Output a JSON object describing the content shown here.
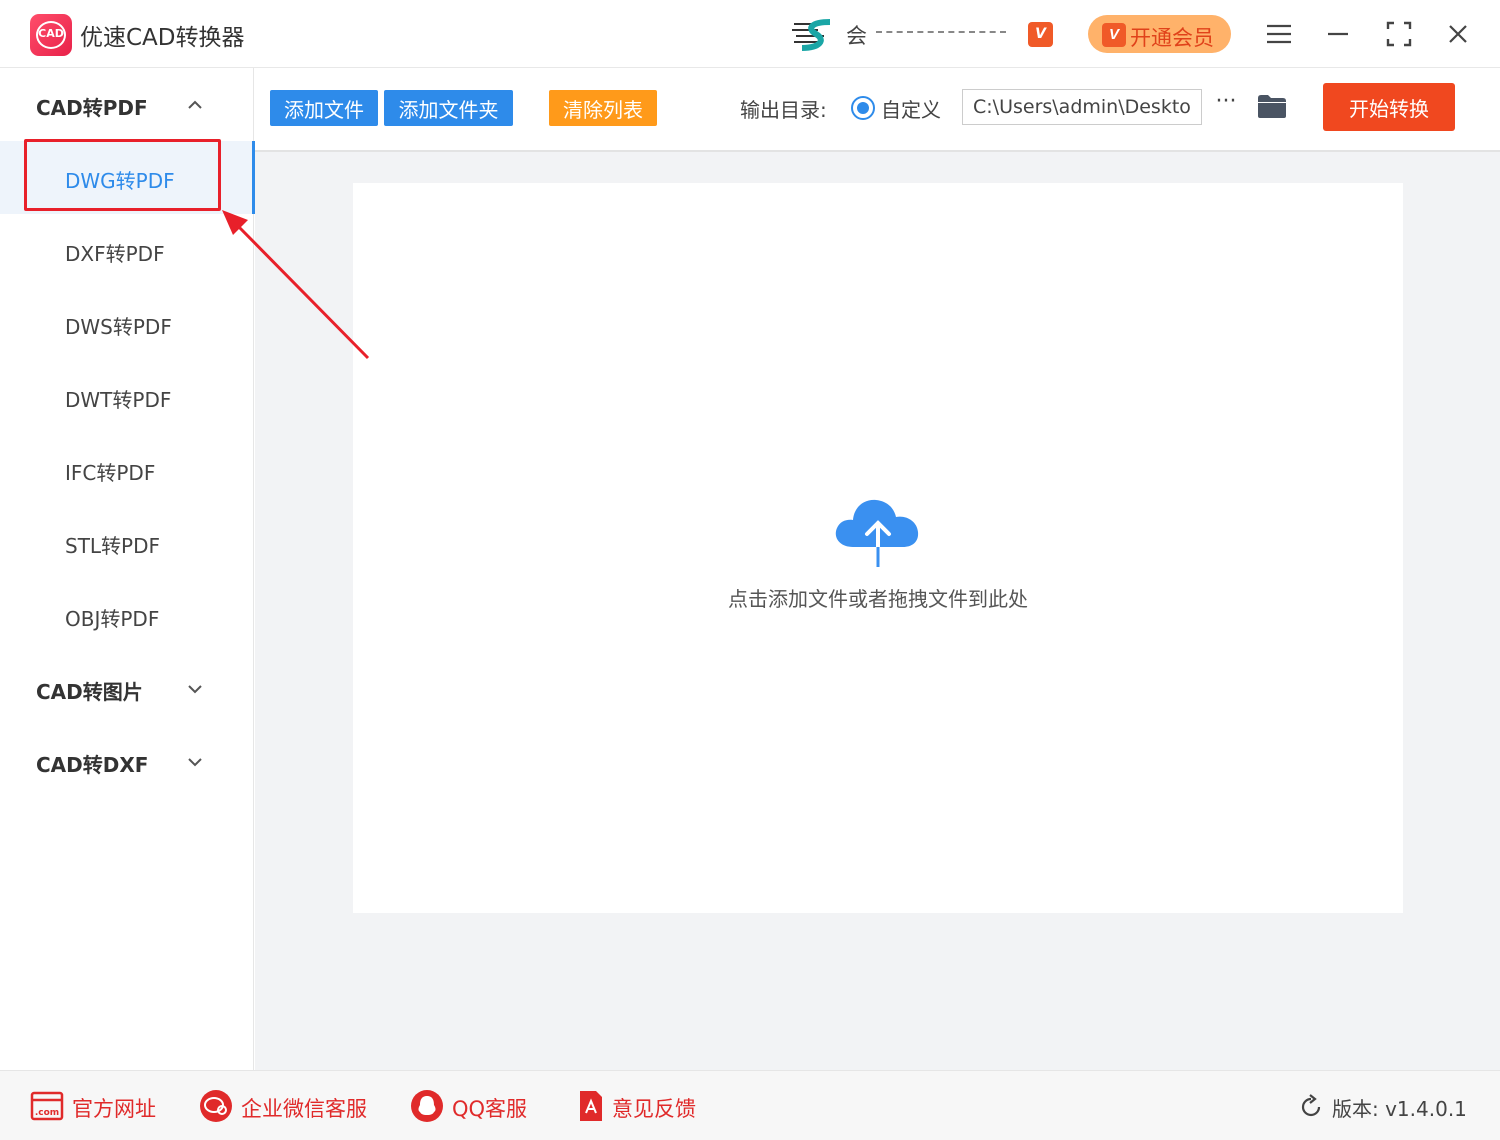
{
  "app": {
    "title": "优速CAD转换器",
    "logo_text": "CAD"
  },
  "user": {
    "name_prefix": "会",
    "vip_badge": "V",
    "upgrade_label": "开通会员",
    "upgrade_badge": "V"
  },
  "sidebar": {
    "groups": [
      {
        "label": "CAD转PDF",
        "expanded": true,
        "items": [
          "DWG转PDF",
          "DXF转PDF",
          "DWS转PDF",
          "DWT转PDF",
          "IFC转PDF",
          "STL转PDF",
          "OBJ转PDF"
        ],
        "active_index": 0
      },
      {
        "label": "CAD转图片",
        "expanded": false
      },
      {
        "label": "CAD转DXF",
        "expanded": false
      }
    ]
  },
  "toolbar": {
    "add_file": "添加文件",
    "add_folder": "添加文件夹",
    "clear_list": "清除列表",
    "output_label": "输出目录:",
    "radio_label": "自定义",
    "output_path": "C:\\Users\\admin\\Deskto",
    "more": "···",
    "start": "开始转换"
  },
  "dropzone": {
    "hint": "点击添加文件或者拖拽文件到此处"
  },
  "footer": {
    "links": [
      "官方网址",
      "企业微信客服",
      "QQ客服",
      "意见反馈"
    ],
    "version_label": "版本: v1.4.0.1"
  },
  "colors": {
    "primary": "#2e8bea",
    "orange": "#ff9a1a",
    "start": "#f0481f",
    "link_red": "#e02a2a"
  }
}
